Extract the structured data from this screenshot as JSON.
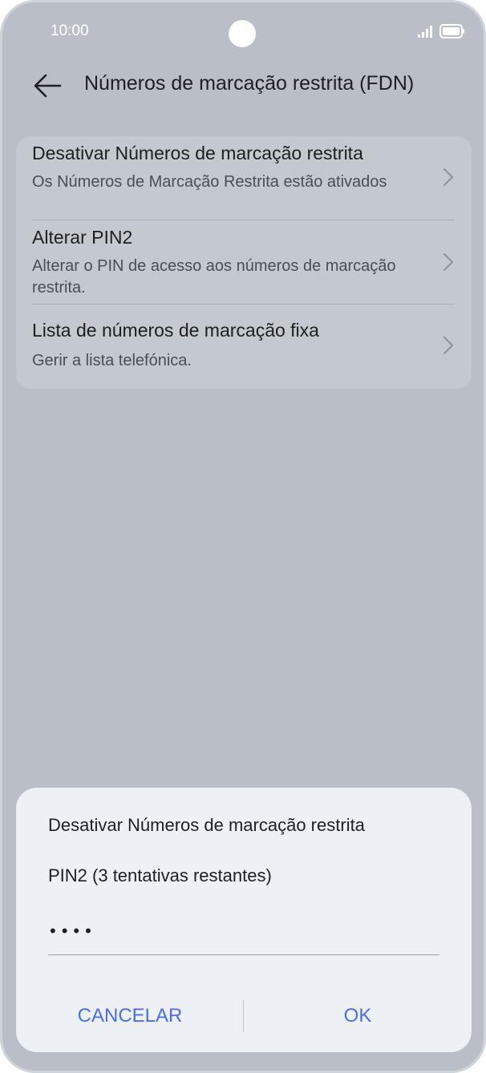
{
  "status_bar": {
    "time": "10:00"
  },
  "header": {
    "title": "Números de marcação restrita (FDN)"
  },
  "settings": {
    "items": [
      {
        "title": "Desativar Números de marcação restrita",
        "subtitle": "Os Números de Marcação Restrita estão ativados"
      },
      {
        "title": "Alterar PIN2",
        "subtitle": "Alterar o PIN de acesso aos números de marcação restrita."
      },
      {
        "title": "Lista de números de marcação fixa",
        "subtitle": "Gerir a lista telefónica."
      }
    ]
  },
  "dialog": {
    "title": "Desativar Números de marcação restrita",
    "pin_label": "PIN2 (3 tentativas restantes)",
    "pin_value": "••••",
    "cancel_label": "CANCELAR",
    "ok_label": "OK"
  },
  "colors": {
    "background": "#b9bec7",
    "card": "#c4c8cf",
    "dialog": "#edf0f4",
    "accent": "#4b6ee3"
  },
  "icons": [
    "back-arrow-icon",
    "camera-icon",
    "signal-icon",
    "battery-icon",
    "chevron-right-icon"
  ]
}
